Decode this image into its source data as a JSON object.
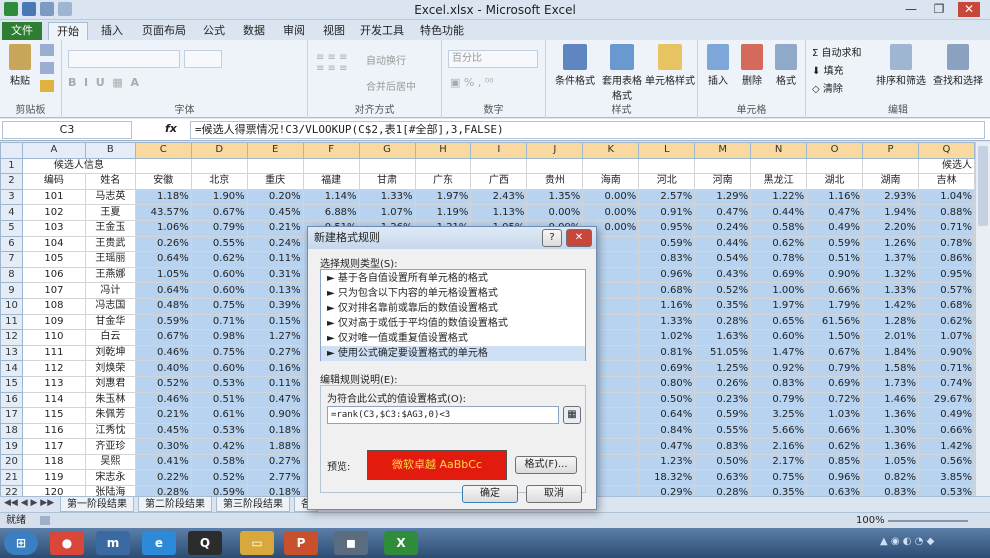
{
  "window": {
    "title": "Excel.xlsx - Microsoft Excel"
  },
  "tabs": [
    "文件",
    "开始",
    "插入",
    "页面布局",
    "公式",
    "数据",
    "审阅",
    "视图",
    "开发工具",
    "特色功能"
  ],
  "ribbon": {
    "clipboard": {
      "label": "剪贴板",
      "paste": "粘贴"
    },
    "font": {
      "label": "字体"
    },
    "align": {
      "label": "对齐方式",
      "wrap": "自动换行",
      "merge": "合并后居中"
    },
    "number": {
      "label": "数字",
      "format": "百分比"
    },
    "styles": {
      "label": "样式",
      "cond": "条件格式",
      "table": "套用表格格式",
      "cell": "单元格样式"
    },
    "cells": {
      "label": "单元格",
      "insert": "插入",
      "delete": "删除",
      "format": "格式"
    },
    "edit": {
      "label": "编辑",
      "autosum": "自动求和",
      "fill": "填充",
      "clear": "清除",
      "sort": "排序和筛选",
      "find": "查找和选择"
    }
  },
  "formula_bar": {
    "name_box": "C3",
    "fx": "fx",
    "formula": "=候选人得票情况!C3/VLOOKUP(C$2,表1[#全部],3,FALSE)"
  },
  "columns": [
    "A",
    "B",
    "C",
    "D",
    "E",
    "F",
    "G",
    "H",
    "I",
    "J",
    "K",
    "L",
    "M",
    "N",
    "O",
    "P",
    "Q"
  ],
  "sheet": {
    "row1": {
      "a": "候选人信息",
      "q": "候选人"
    },
    "headers": [
      "编码",
      "姓名",
      "安徽",
      "北京",
      "重庆",
      "福建",
      "甘肃",
      "广东",
      "广西",
      "贵州",
      "海南",
      "河北",
      "河南",
      "黑龙江",
      "湖北",
      "湖南",
      "吉林"
    ],
    "rows": [
      {
        "n": "3",
        "cells": [
          "101",
          "马志英",
          "1.18%",
          "1.90%",
          "0.20%",
          "1.14%",
          "1.33%",
          "1.97%",
          "2.43%",
          "1.35%",
          "0.00%",
          "2.57%",
          "1.29%",
          "1.22%",
          "1.16%",
          "2.93%",
          "1.04%"
        ]
      },
      {
        "n": "4",
        "cells": [
          "102",
          "王夏",
          "43.57%",
          "0.67%",
          "0.45%",
          "6.88%",
          "1.07%",
          "1.19%",
          "1.13%",
          "0.00%",
          "0.00%",
          "0.91%",
          "0.47%",
          "0.44%",
          "0.47%",
          "1.94%",
          "0.88%"
        ]
      },
      {
        "n": "5",
        "cells": [
          "103",
          "王金玉",
          "1.06%",
          "0.79%",
          "0.21%",
          "0.51%",
          "1.26%",
          "1.21%",
          "1.05%",
          "0.00%",
          "0.00%",
          "0.95%",
          "0.24%",
          "0.58%",
          "0.49%",
          "2.20%",
          "0.71%"
        ]
      },
      {
        "n": "6",
        "cells": [
          "104",
          "王贵武",
          "0.26%",
          "0.55%",
          "0.24%",
          "",
          "",
          "",
          "",
          "",
          "",
          "0.59%",
          "0.44%",
          "0.62%",
          "0.59%",
          "1.26%",
          "0.78%"
        ]
      },
      {
        "n": "7",
        "cells": [
          "105",
          "王瑶丽",
          "0.64%",
          "0.62%",
          "0.11%",
          "",
          "",
          "",
          "",
          "",
          "",
          "0.83%",
          "0.54%",
          "0.78%",
          "0.51%",
          "1.37%",
          "0.86%"
        ]
      },
      {
        "n": "8",
        "cells": [
          "106",
          "王燕娜",
          "1.05%",
          "0.60%",
          "0.31%",
          "",
          "",
          "",
          "",
          "",
          "",
          "0.96%",
          "0.43%",
          "0.69%",
          "0.90%",
          "1.32%",
          "0.95%"
        ]
      },
      {
        "n": "9",
        "cells": [
          "107",
          "冯计",
          "0.64%",
          "0.60%",
          "0.13%",
          "",
          "",
          "",
          "",
          "",
          "",
          "0.68%",
          "0.52%",
          "1.00%",
          "0.66%",
          "1.33%",
          "0.57%"
        ]
      },
      {
        "n": "10",
        "cells": [
          "108",
          "冯志国",
          "0.48%",
          "0.75%",
          "0.39%",
          "",
          "",
          "",
          "",
          "",
          "",
          "1.16%",
          "0.35%",
          "1.97%",
          "1.79%",
          "1.42%",
          "0.68%"
        ]
      },
      {
        "n": "11",
        "cells": [
          "109",
          "甘金华",
          "0.59%",
          "0.71%",
          "0.15%",
          "",
          "",
          "",
          "",
          "",
          "",
          "1.33%",
          "0.28%",
          "0.65%",
          "61.56%",
          "1.28%",
          "0.62%"
        ]
      },
      {
        "n": "12",
        "cells": [
          "110",
          "白云",
          "0.67%",
          "0.98%",
          "1.27%",
          "",
          "",
          "",
          "",
          "",
          "",
          "1.02%",
          "1.63%",
          "0.60%",
          "1.50%",
          "2.01%",
          "1.07%"
        ]
      },
      {
        "n": "13",
        "cells": [
          "111",
          "刘乾坤",
          "0.46%",
          "0.75%",
          "0.27%",
          "",
          "",
          "",
          "",
          "",
          "",
          "0.81%",
          "51.05%",
          "1.47%",
          "0.67%",
          "1.84%",
          "0.90%"
        ]
      },
      {
        "n": "14",
        "cells": [
          "112",
          "刘焕荣",
          "0.40%",
          "0.60%",
          "0.16%",
          "",
          "",
          "",
          "",
          "",
          "",
          "0.69%",
          "1.25%",
          "0.92%",
          "0.79%",
          "1.58%",
          "0.71%"
        ]
      },
      {
        "n": "15",
        "cells": [
          "113",
          "刘惠君",
          "0.52%",
          "0.53%",
          "0.11%",
          "",
          "",
          "",
          "",
          "",
          "",
          "0.80%",
          "0.26%",
          "0.83%",
          "0.69%",
          "1.73%",
          "0.74%"
        ]
      },
      {
        "n": "16",
        "cells": [
          "114",
          "朱玉林",
          "0.46%",
          "0.51%",
          "0.47%",
          "",
          "",
          "",
          "",
          "",
          "",
          "0.50%",
          "0.23%",
          "0.79%",
          "0.72%",
          "1.46%",
          "29.67%"
        ]
      },
      {
        "n": "17",
        "cells": [
          "115",
          "朱佩芳",
          "0.21%",
          "0.61%",
          "0.90%",
          "",
          "",
          "",
          "",
          "",
          "",
          "0.64%",
          "0.59%",
          "3.25%",
          "1.03%",
          "1.36%",
          "0.49%"
        ]
      },
      {
        "n": "18",
        "cells": [
          "116",
          "江秀忱",
          "0.45%",
          "0.53%",
          "0.18%",
          "",
          "",
          "",
          "",
          "",
          "",
          "0.84%",
          "0.55%",
          "5.66%",
          "0.66%",
          "1.30%",
          "0.66%"
        ]
      },
      {
        "n": "19",
        "cells": [
          "117",
          "齐亚珍",
          "0.30%",
          "0.42%",
          "1.88%",
          "",
          "",
          "",
          "",
          "",
          "",
          "0.47%",
          "0.83%",
          "2.16%",
          "0.62%",
          "1.36%",
          "1.42%"
        ]
      },
      {
        "n": "20",
        "cells": [
          "118",
          "吴熙",
          "0.41%",
          "0.58%",
          "0.27%",
          "",
          "",
          "",
          "",
          "",
          "",
          "1.23%",
          "0.50%",
          "2.17%",
          "0.85%",
          "1.05%",
          "0.56%"
        ]
      },
      {
        "n": "21",
        "cells": [
          "119",
          "宋志永",
          "0.22%",
          "0.52%",
          "2.77%",
          "",
          "",
          "",
          "",
          "",
          "",
          "18.32%",
          "0.63%",
          "0.75%",
          "0.96%",
          "0.82%",
          "3.85%"
        ]
      },
      {
        "n": "22",
        "cells": [
          "120",
          "张陆海",
          "0.28%",
          "0.59%",
          "0.18%",
          "",
          "",
          "",
          "",
          "",
          "",
          "0.29%",
          "0.28%",
          "0.35%",
          "0.63%",
          "0.83%",
          "0.53%"
        ]
      },
      {
        "n": "23",
        "cells": [
          "121",
          "张桂梅",
          "0.23%",
          "0.40%",
          "0.07%",
          "",
          "",
          "",
          "",
          "",
          "",
          "0.33%",
          "0.36%",
          "0.52%",
          "0.28%",
          "0.64%",
          "0.26%"
        ]
      }
    ]
  },
  "sheet_tabs": [
    "第一阶段结果",
    "第二阶段结果",
    "第三阶段结果",
    "各"
  ],
  "status": {
    "ready": "就绪",
    "zoom": "100%"
  },
  "dialog": {
    "title": "新建格式规则",
    "help": "?",
    "close": "✕",
    "select_label": "选择规则类型(S):",
    "rule_types": [
      "► 基于各自值设置所有单元格的格式",
      "► 只为包含以下内容的单元格设置格式",
      "► 仅对排名靠前或靠后的数值设置格式",
      "► 仅对高于或低于平均值的数值设置格式",
      "► 仅对唯一值或重复值设置格式",
      "► 使用公式确定要设置格式的单元格"
    ],
    "edit_label": "编辑规则说明(E):",
    "formula_label": "为符合此公式的值设置格式(O):",
    "formula": "=rank(C3,$C3:$AG3,0)<3",
    "preview_label": "预览:",
    "preview_text": "微软卓越  AaBbCc",
    "format_button": "格式(F)...",
    "ok": "确定",
    "cancel": "取消"
  },
  "colors": {
    "selection": "#b7d3ef",
    "preview_bg": "#e31b0e",
    "preview_fg": "#ffd84a",
    "file_tab": "#2f7d32"
  }
}
